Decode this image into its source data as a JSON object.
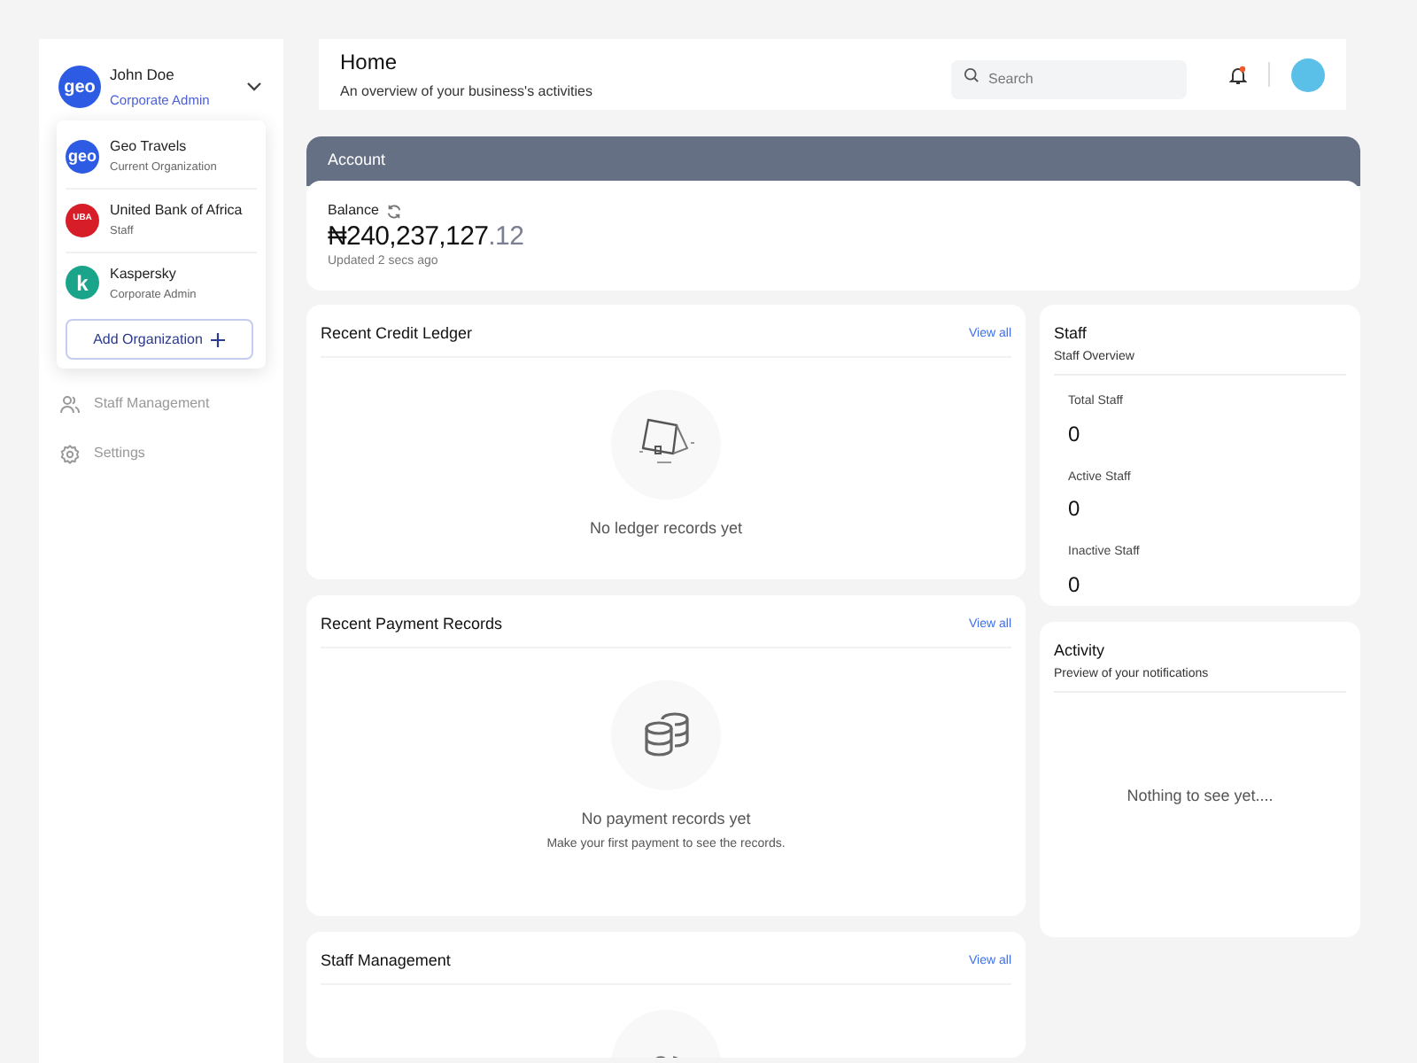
{
  "sidebar": {
    "user": {
      "logo_text": "geo",
      "name": "John Doe",
      "role": "Corporate Admin",
      "expanded": true
    },
    "organizations": [
      {
        "logo_text": "geo",
        "kind": "geo",
        "name": "Geo Travels",
        "role": "Current Organization"
      },
      {
        "logo_text": "UBA",
        "kind": "uba",
        "name": "United Bank of Africa",
        "role": "Staff"
      },
      {
        "logo_text": "k",
        "kind": "kaspersky",
        "name": "Kaspersky",
        "role": "Corporate Admin"
      }
    ],
    "add_button": "Add Organization",
    "nav": [
      {
        "kind": "staff",
        "label": "Staff Management"
      },
      {
        "kind": "settings",
        "label": "Settings"
      }
    ]
  },
  "header": {
    "title": "Home",
    "subtitle": "An overview of your business's activities",
    "search": {
      "placeholder": "Search"
    }
  },
  "account": {
    "title": "Account",
    "balance_label": "Balance",
    "amount_main": "₦240,237,127",
    "amount_fraction": ".12",
    "updated": "Updated 2 secs ago"
  },
  "cards": [
    {
      "kind": "ledger",
      "title": "Recent Credit Ledger",
      "link": "View all",
      "empty": "No ledger records yet"
    },
    {
      "kind": "payment",
      "title": "Recent Payment Records",
      "link": "View all",
      "empty": "No payment records yet",
      "hint": "Make your first payment to see the records."
    },
    {
      "kind": "staff",
      "title": "Staff Management",
      "link": "View all"
    }
  ],
  "staff": {
    "title": "Staff",
    "subtitle": "Staff Overview",
    "stats": [
      {
        "label": "Total Staff",
        "value": "0"
      },
      {
        "label": "Active Staff",
        "value": "0"
      },
      {
        "label": "Inactive Staff",
        "value": "0"
      }
    ]
  },
  "activity": {
    "title": "Activity",
    "subtitle": "Preview of your notifications",
    "empty": "Nothing to see yet...."
  }
}
